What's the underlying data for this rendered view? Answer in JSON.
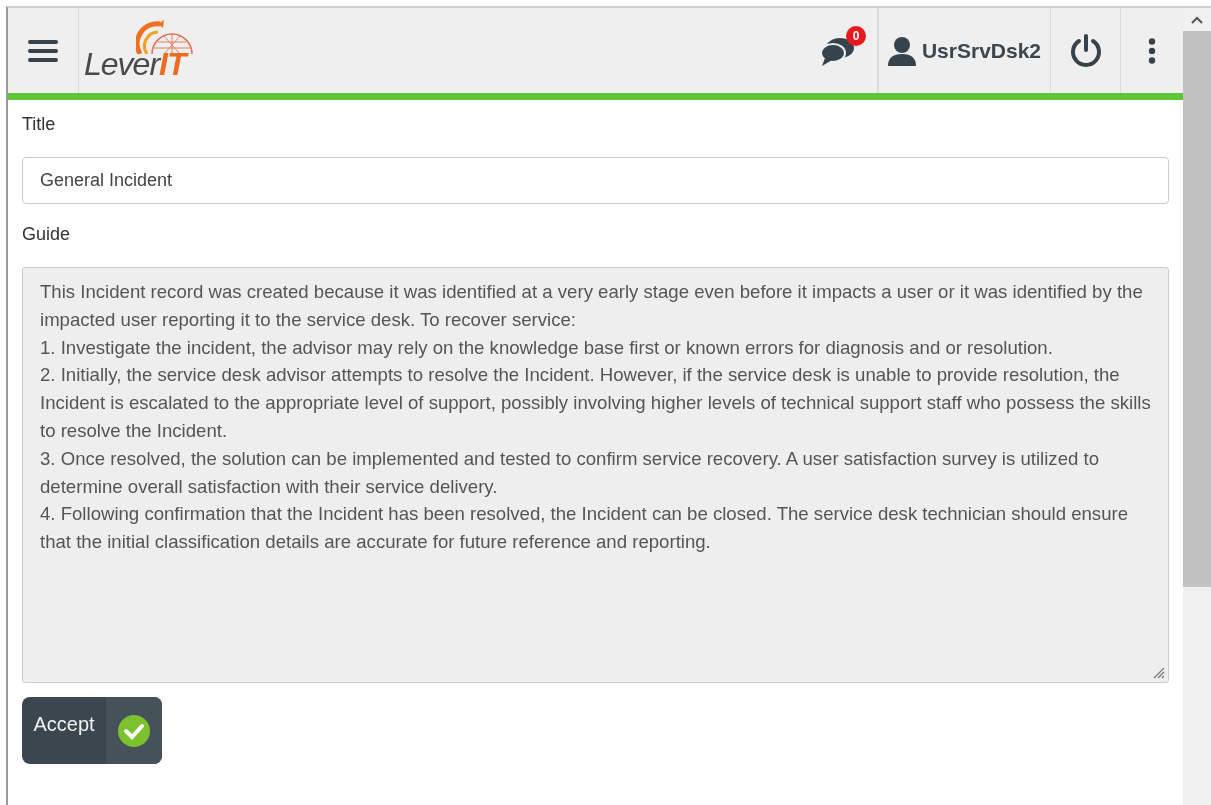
{
  "header": {
    "logo": {
      "text": "Lever",
      "accent": "IT"
    },
    "notifications": {
      "count": "0"
    },
    "user": {
      "name": "UsrSrvDsk2"
    }
  },
  "form": {
    "title_label": "Title",
    "title_value": "General Incident",
    "guide_label": "Guide",
    "guide_lines": [
      "This Incident record was created because it was identified at a very early stage even before it impacts a user or it was identified by the impacted user reporting it to the service desk. To recover service:",
      "1. Investigate the incident, the advisor may rely on the knowledge base first or known errors for diagnosis and or resolution.",
      "2. Initially, the service desk advisor attempts to resolve the Incident. However, if the service desk is unable to provide resolution, the Incident is escalated to the appropriate level of support, possibly involving higher levels of technical support staff who possess the skills to resolve the Incident.",
      "3. Once resolved, the solution can be implemented and tested to confirm service recovery. A user satisfaction survey is utilized to determine overall satisfaction with their service delivery.",
      "4. Following confirmation that the Incident has been resolved, the Incident can be closed. The service desk technician should ensure that the initial classification details are accurate for future reference and reporting."
    ],
    "accept_label": "Accept"
  }
}
